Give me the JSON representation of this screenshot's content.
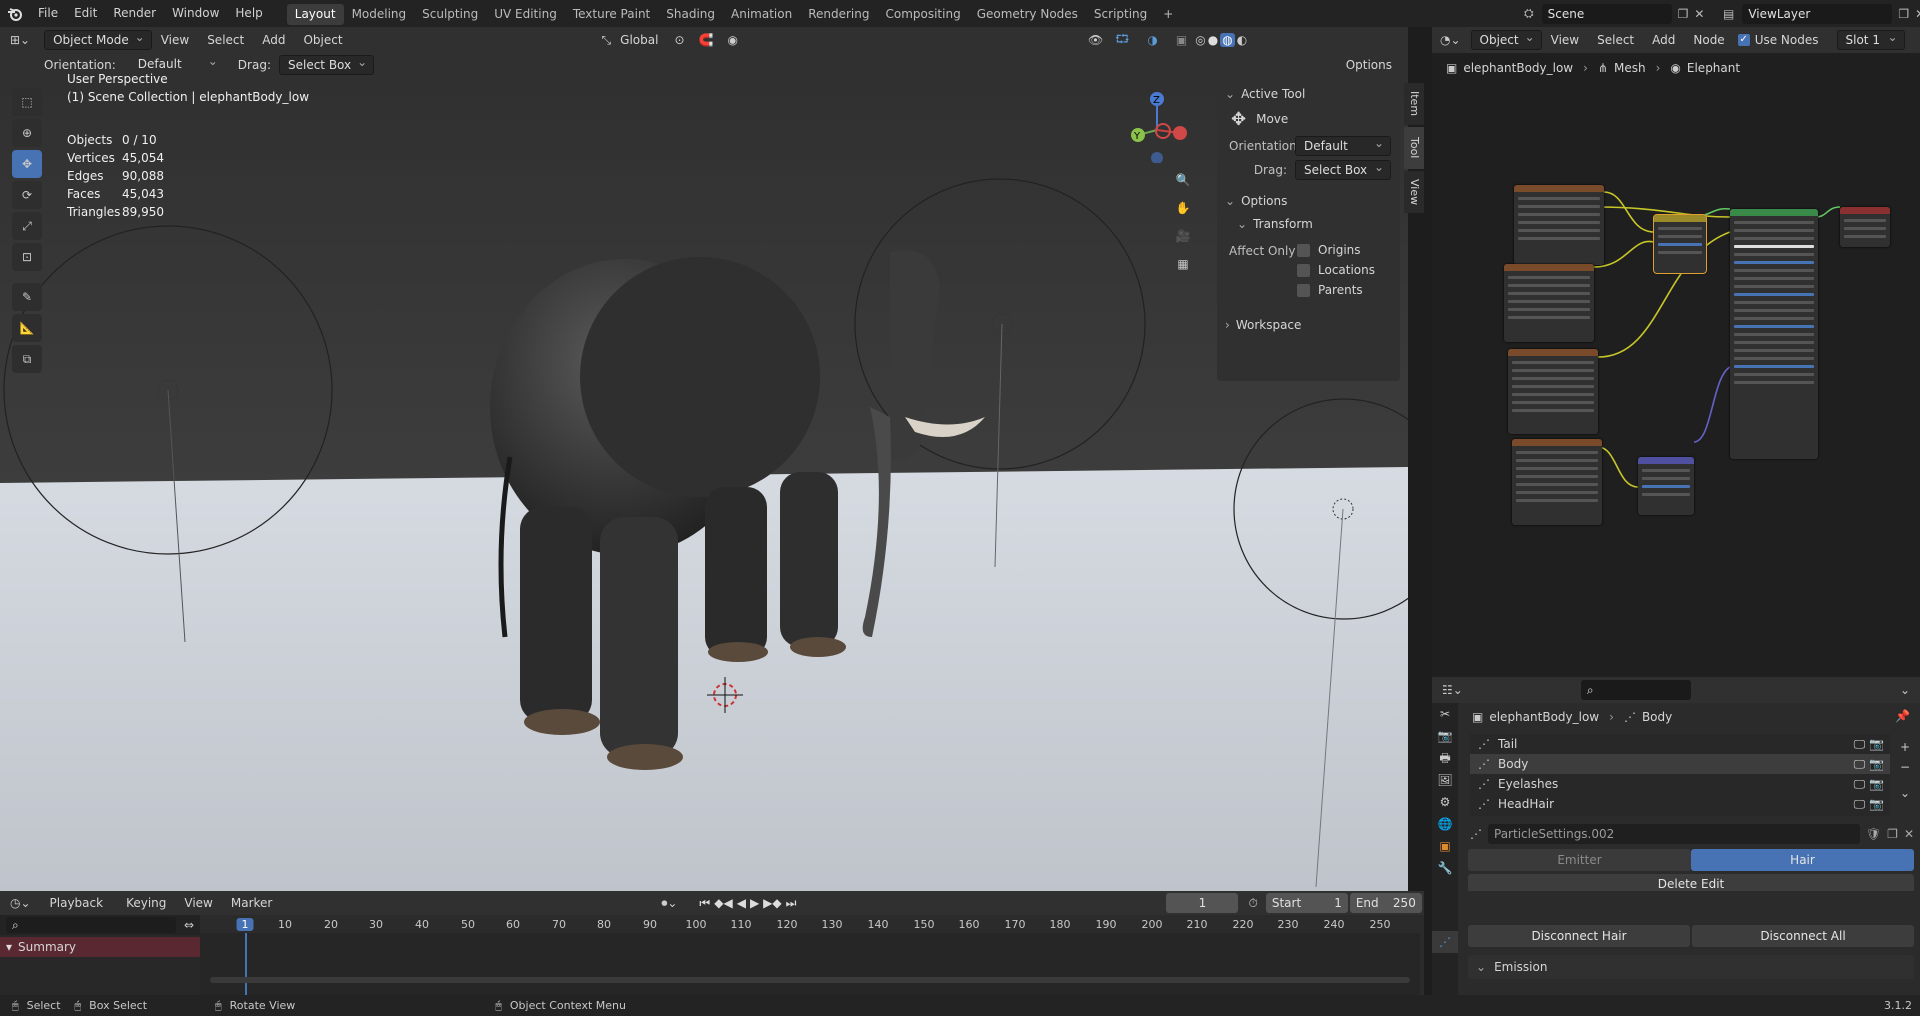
{
  "topbar": {
    "menus": [
      "File",
      "Edit",
      "Render",
      "Window",
      "Help"
    ],
    "workspaces": [
      "Layout",
      "Modeling",
      "Sculpting",
      "UV Editing",
      "Texture Paint",
      "Shading",
      "Animation",
      "Rendering",
      "Compositing",
      "Geometry Nodes",
      "Scripting"
    ],
    "active_workspace": "Layout",
    "scene_label": "Scene",
    "viewlayer_label": "ViewLayer"
  },
  "viewport_header": {
    "mode": "Object Mode",
    "menus": [
      "View",
      "Select",
      "Add",
      "Object"
    ],
    "transform_orientation": "Global"
  },
  "tool_settings": {
    "orientation_label": "Orientation:",
    "orientation_value": "Default",
    "drag_label": "Drag:",
    "drag_value": "Select Box",
    "options_label": "Options"
  },
  "overlay_info": {
    "view_name": "User Perspective",
    "collection": "(1) Scene Collection | elephantBody_low",
    "stats": [
      {
        "label": "Objects",
        "value": "0 / 10"
      },
      {
        "label": "Vertices",
        "value": "45,054"
      },
      {
        "label": "Edges",
        "value": "90,088"
      },
      {
        "label": "Faces",
        "value": "45,043"
      },
      {
        "label": "Triangles",
        "value": "89,950"
      }
    ]
  },
  "npanel": {
    "active_tool_title": "Active Tool",
    "tool_name": "Move",
    "orientation_label": "Orientation",
    "orientation_value": "Default",
    "drag_label": "Drag:",
    "drag_value": "Select Box",
    "options_title": "Options",
    "transform_title": "Transform",
    "affect_only_label": "Affect Only",
    "affect_options": [
      "Origins",
      "Locations",
      "Parents"
    ],
    "workspace_title": "Workspace",
    "tabs": [
      "Item",
      "Tool",
      "View"
    ]
  },
  "node_editor": {
    "header_object": "Object",
    "menus": [
      "View",
      "Select",
      "Add",
      "Node"
    ],
    "use_nodes_label": "Use Nodes",
    "slot": "Slot 1",
    "breadcrumb": [
      "elephantBody_low",
      "Mesh",
      "Elephant"
    ]
  },
  "properties": {
    "breadcrumb": [
      "elephantBody_low",
      "Body"
    ],
    "particle_systems": [
      "Tail",
      "Body",
      "Eyelashes",
      "HeadHair"
    ],
    "selected_system": "Body",
    "settings_name": "ParticleSettings.002",
    "type_emitter": "Emitter",
    "type_hair": "Hair",
    "delete_edit": "Delete Edit",
    "disconnect_hair": "Disconnect Hair",
    "disconnect_all": "Disconnect All",
    "emission_title": "Emission"
  },
  "timeline": {
    "menus": [
      "Playback",
      "Keying",
      "View",
      "Marker"
    ],
    "current_frame": "1",
    "start_label": "Start",
    "start_value": "1",
    "end_label": "End",
    "end_value": "250",
    "ticks": [
      "1",
      "10",
      "20",
      "30",
      "40",
      "50",
      "60",
      "70",
      "80",
      "90",
      "100",
      "110",
      "120",
      "130",
      "140",
      "150",
      "160",
      "170",
      "180",
      "190",
      "200",
      "210",
      "220",
      "230",
      "240",
      "250"
    ],
    "summary_label": "Summary"
  },
  "statusbar": {
    "items": [
      "Select",
      "Box Select",
      "Rotate View",
      "Object Context Menu"
    ],
    "version": "3.1.2"
  },
  "colors": {
    "accent": "#4772b3",
    "header_bg": "#303030",
    "panel_bg": "#2b2b2b",
    "sel_blue": "#4772b3"
  }
}
